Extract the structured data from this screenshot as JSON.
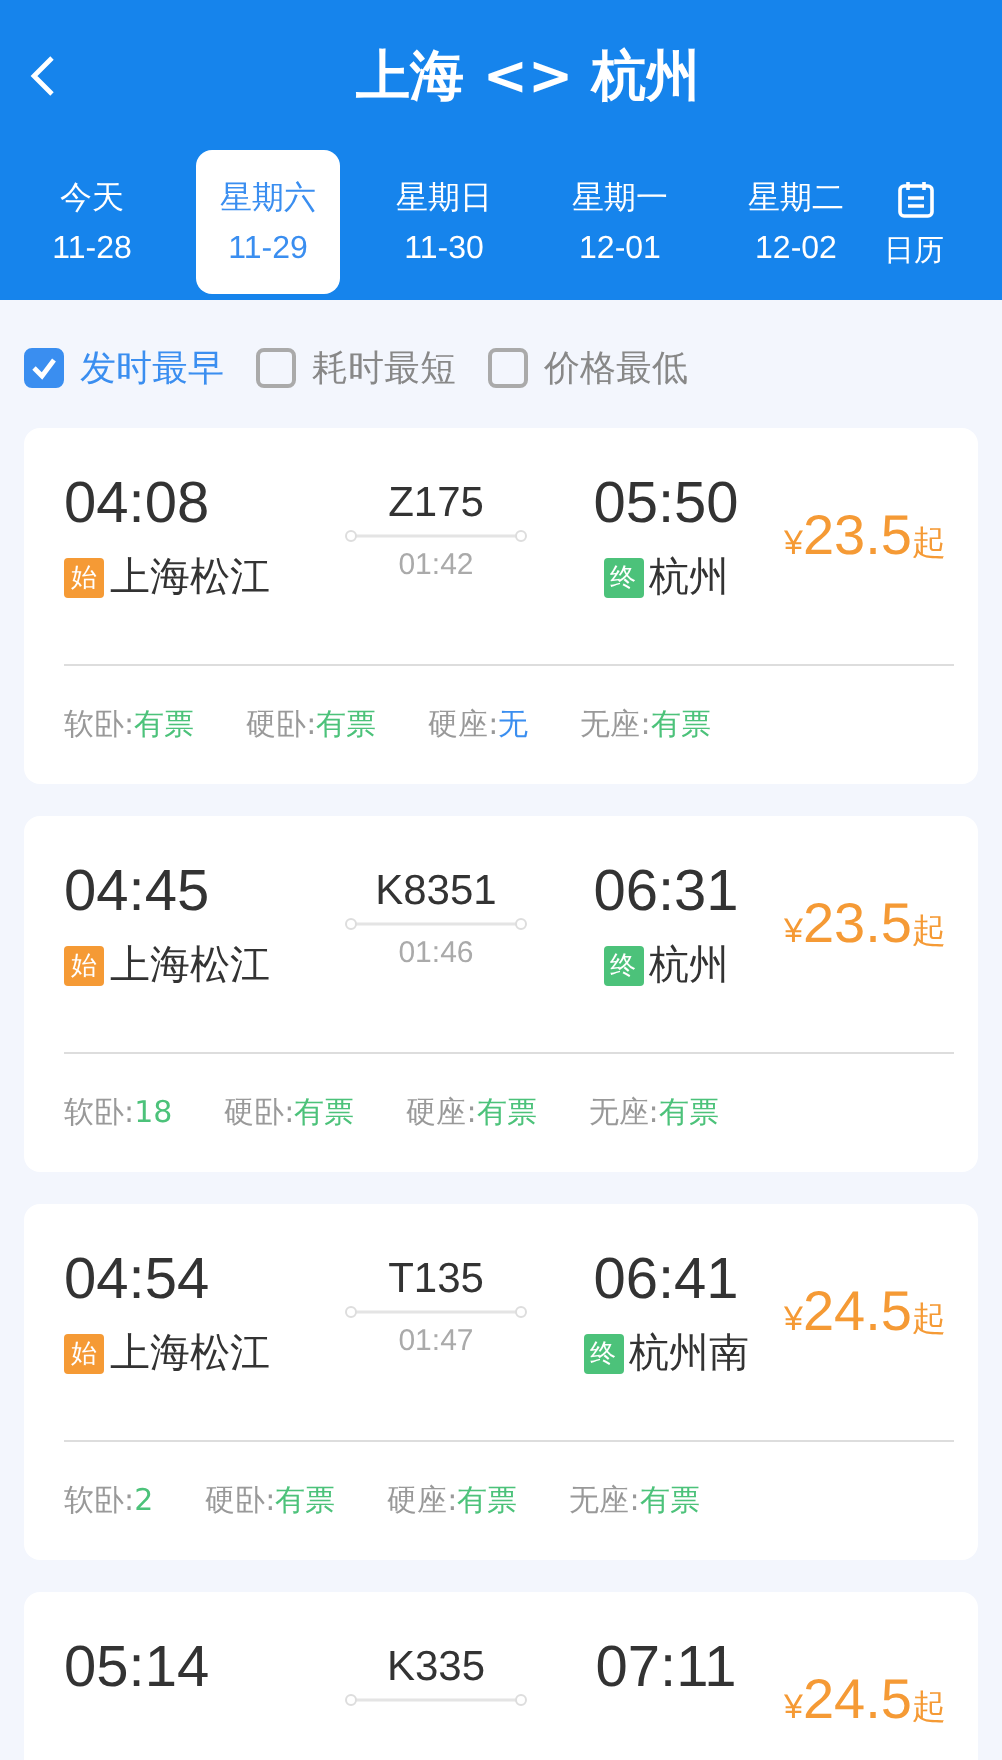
{
  "header": {
    "title": "上海 <> 杭州"
  },
  "date_tabs": [
    {
      "day": "今天",
      "date": "11-28",
      "selected": false
    },
    {
      "day": "星期六",
      "date": "11-29",
      "selected": true
    },
    {
      "day": "星期日",
      "date": "11-30",
      "selected": false
    },
    {
      "day": "星期一",
      "date": "12-01",
      "selected": false
    },
    {
      "day": "星期二",
      "date": "12-02",
      "selected": false
    }
  ],
  "calendar_button": {
    "label": "日历"
  },
  "sort_options": [
    {
      "label": "发时最早",
      "checked": true
    },
    {
      "label": "耗时最短",
      "checked": false
    },
    {
      "label": "价格最低",
      "checked": false
    }
  ],
  "trains": [
    {
      "depart": "04:08",
      "train_no": "Z175",
      "duration": "01:42",
      "arrive": "05:50",
      "from_tag": "始",
      "from": "上海松江",
      "to_tag": "终",
      "to": "杭州",
      "currency": "¥",
      "price": "23.5",
      "price_suffix": "起",
      "seats": [
        {
          "name": "软卧:",
          "value": "有票",
          "available": true
        },
        {
          "name": "硬卧:",
          "value": "有票",
          "available": true
        },
        {
          "name": "硬座:",
          "value": "无",
          "available": false
        },
        {
          "name": "无座:",
          "value": "有票",
          "available": true
        }
      ]
    },
    {
      "depart": "04:45",
      "train_no": "K8351",
      "duration": "01:46",
      "arrive": "06:31",
      "from_tag": "始",
      "from": "上海松江",
      "to_tag": "终",
      "to": "杭州",
      "currency": "¥",
      "price": "23.5",
      "price_suffix": "起",
      "seats": [
        {
          "name": "软卧:",
          "value": "18",
          "available": true
        },
        {
          "name": "硬卧:",
          "value": "有票",
          "available": true
        },
        {
          "name": "硬座:",
          "value": "有票",
          "available": true
        },
        {
          "name": "无座:",
          "value": "有票",
          "available": true
        }
      ]
    },
    {
      "depart": "04:54",
      "train_no": "T135",
      "duration": "01:47",
      "arrive": "06:41",
      "from_tag": "始",
      "from": "上海松江",
      "to_tag": "终",
      "to": "杭州南",
      "currency": "¥",
      "price": "24.5",
      "price_suffix": "起",
      "seats": [
        {
          "name": "软卧:",
          "value": "2",
          "available": true
        },
        {
          "name": "硬卧:",
          "value": "有票",
          "available": true
        },
        {
          "name": "硬座:",
          "value": "有票",
          "available": true
        },
        {
          "name": "无座:",
          "value": "有票",
          "available": true
        }
      ]
    },
    {
      "depart": "05:14",
      "train_no": "K335",
      "arrive": "07:11",
      "currency": "¥",
      "price": "24.5",
      "price_suffix": "起"
    }
  ]
}
